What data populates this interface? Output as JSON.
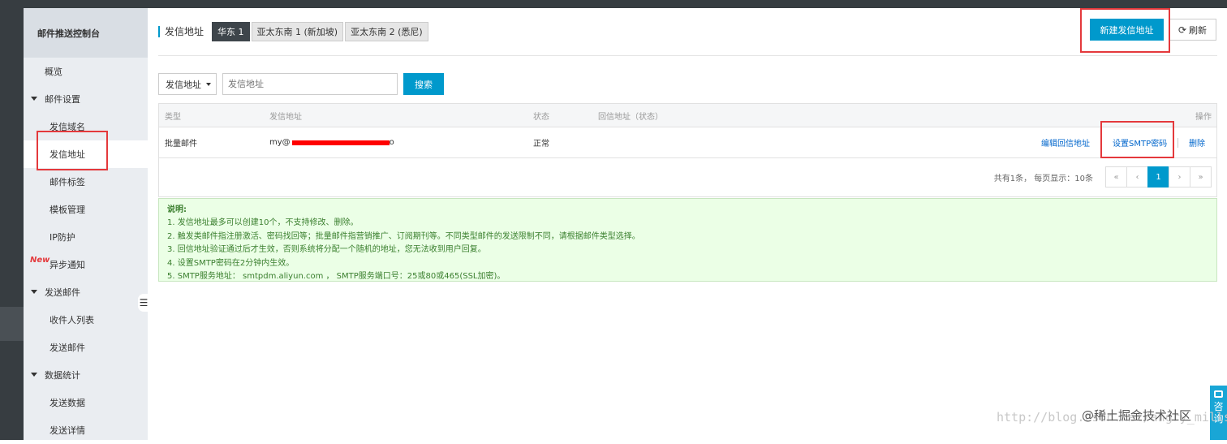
{
  "sidebar": {
    "title": "邮件推送控制台",
    "overview": "概览",
    "group_mail_settings": "邮件设置",
    "items_mail_settings": [
      "发信域名",
      "发信地址",
      "邮件标签",
      "模板管理",
      "IP防护",
      "异步通知"
    ],
    "new_badge": "New",
    "group_send": "发送邮件",
    "items_send": [
      "收件人列表",
      "发送邮件"
    ],
    "group_stats": "数据统计",
    "items_stats": [
      "发送数据",
      "发送详情"
    ],
    "collapse_icon": "list-icon"
  },
  "header": {
    "title": "发信地址",
    "regions": [
      "华东 1",
      "亚太东南 1 (新加坡)",
      "亚太东南 2 (悉尼)"
    ],
    "new_button": "新建发信地址",
    "refresh_button": "刷新"
  },
  "search": {
    "select_value": "发信地址",
    "input_placeholder": "发信地址",
    "button": "搜索"
  },
  "table": {
    "columns": [
      "类型",
      "发信地址",
      "状态",
      "回信地址（状态）",
      "操作"
    ],
    "rows": [
      {
        "type": "批量邮件",
        "address_visible": "my@",
        "address_tail": "o",
        "status": "正常",
        "reply": "",
        "actions": [
          "编辑回信地址",
          "设置SMTP密码",
          "删除"
        ]
      }
    ],
    "pager_info": "共有1条， 每页显示：10条",
    "pager": [
      "«",
      "‹",
      "1",
      "›",
      "»"
    ]
  },
  "notice": {
    "title": "说明:",
    "lines": [
      "1. 发信地址最多可以创建10个，不支持修改、删除。",
      "2. 触发类邮件指注册激活、密码找回等；批量邮件指营销推广、订阅期刊等。不同类型邮件的发送限制不同，请根据邮件类型选择。",
      "3. 回信地址验证通过后才生效，否则系统将分配一个随机的地址，您无法收到用户回复。",
      "4. 设置SMTP密码在2分钟内生效。",
      "5. SMTP服务地址：  smtpdm.aliyun.com ， SMTP服务端口号：25或80或465(SSL加密)。"
    ]
  },
  "float_button": {
    "label_1": "咨",
    "label_2": "询"
  },
  "watermark": {
    "url": "http://blog.csdn.net/angry_mills",
    "brand": "@稀土掘金技术社区"
  },
  "colors": {
    "primary": "#0099cc",
    "highlight_box": "#e4393c",
    "sidebar_bg": "#eaedf1",
    "notice_bg": "#ebffe6"
  }
}
